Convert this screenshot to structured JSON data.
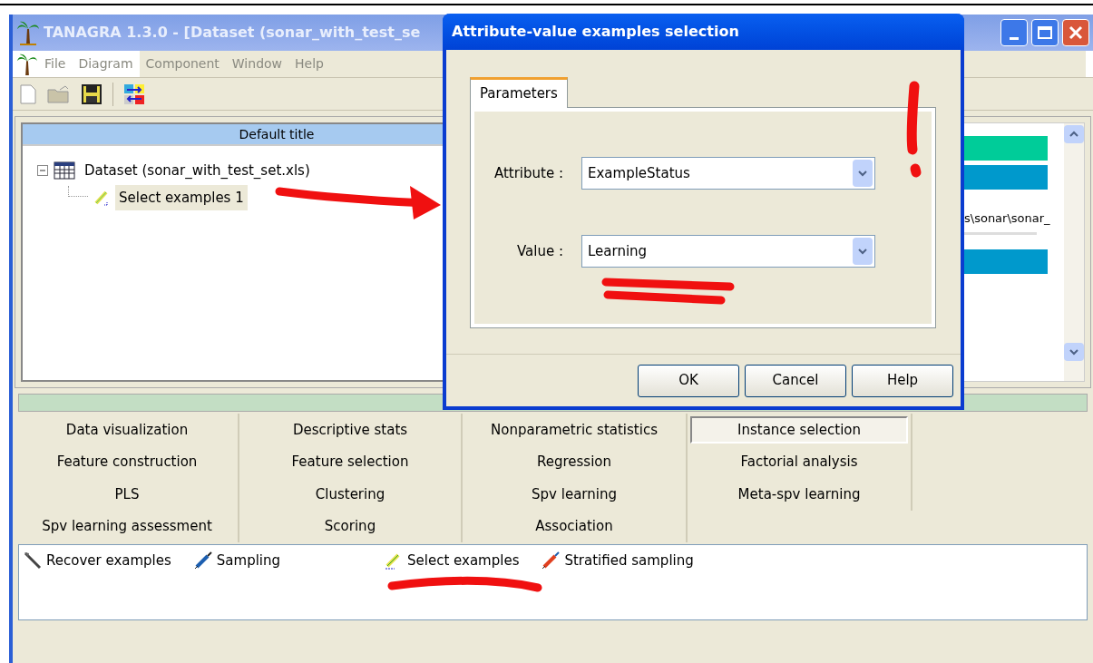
{
  "main_window": {
    "title": "TANAGRA 1.3.0 - [Dataset (sonar_with_test_se",
    "menu": [
      "File",
      "Diagram",
      "Component",
      "Window",
      "Help"
    ]
  },
  "diagram": {
    "title": "Default title",
    "tree": [
      {
        "label": "Dataset (sonar_with_test_set.xls)",
        "expanded": true,
        "selected": false,
        "children": [
          {
            "label": "Select examples 1",
            "selected": true
          }
        ]
      }
    ],
    "side_text": "s\\sonar\\sonar_"
  },
  "components": {
    "categories": [
      {
        "label": "Data visualization",
        "selected": false
      },
      {
        "label": "Descriptive stats",
        "selected": false
      },
      {
        "label": "Nonparametric statistics",
        "selected": false
      },
      {
        "label": "Instance selection",
        "selected": true
      },
      {
        "label": "Feature construction",
        "selected": false
      },
      {
        "label": "Feature selection",
        "selected": false
      },
      {
        "label": "Regression",
        "selected": false
      },
      {
        "label": "Factorial analysis",
        "selected": false
      },
      {
        "label": "PLS",
        "selected": false
      },
      {
        "label": "Clustering",
        "selected": false
      },
      {
        "label": "Spv learning",
        "selected": false
      },
      {
        "label": "Meta-spv learning",
        "selected": false
      },
      {
        "label": "Spv learning assessment",
        "selected": false
      },
      {
        "label": "Scoring",
        "selected": false
      },
      {
        "label": "Association",
        "selected": false
      }
    ],
    "items": [
      {
        "label": "Recover examples",
        "kind": "wand"
      },
      {
        "label": "Sampling",
        "kind": "syringe"
      },
      {
        "label": "Select examples",
        "kind": "pencil"
      },
      {
        "label": "Stratified sampling",
        "kind": "syringe-red"
      }
    ]
  },
  "dialog": {
    "title": "Attribute-value examples selection",
    "tabs": [
      {
        "label": "Parameters",
        "selected": true
      }
    ],
    "fields": [
      {
        "label": "Attribute :",
        "value": "ExampleStatus"
      },
      {
        "label": "Value :",
        "value": "Learning"
      }
    ],
    "buttons": [
      "OK",
      "Cancel",
      "Help"
    ]
  }
}
